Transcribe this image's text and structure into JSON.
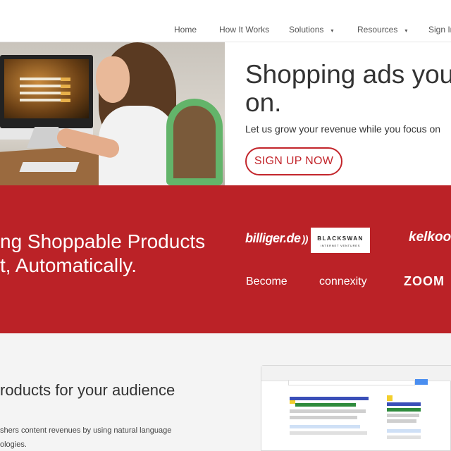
{
  "nav": {
    "items": [
      {
        "label": "Home"
      },
      {
        "label": "How It Works"
      },
      {
        "label": "Solutions",
        "caret": "▾"
      },
      {
        "label": "Resources",
        "caret": "▾"
      },
      {
        "label": "Sign In"
      }
    ]
  },
  "hero": {
    "title_line1": "Shopping ads you",
    "title_line2": "on.",
    "subtitle": "Let us grow your revenue while you focus on",
    "cta_label": "SIGN UP NOW"
  },
  "band": {
    "line1": "ng Shoppable Products",
    "line2": "t, Automatically.",
    "logos": {
      "billiger": "billiger.de",
      "blackswan_main": "BLACKSWAN",
      "blackswan_sub": "INTERNET VENTURES",
      "kelkoo": "kelkoo",
      "become": "Become",
      "connexity": "connexity",
      "zoom": "ZOOM"
    }
  },
  "lower": {
    "title": "roducts for your audience",
    "body_line1": "shers content revenues by using natural language",
    "body_line2": "ologies."
  },
  "colors": {
    "brand_red": "#bb2227",
    "cta_red": "#c3262c"
  },
  "icons": {
    "caret": "chevron-down-icon",
    "wifi": "signal-waves-icon"
  }
}
